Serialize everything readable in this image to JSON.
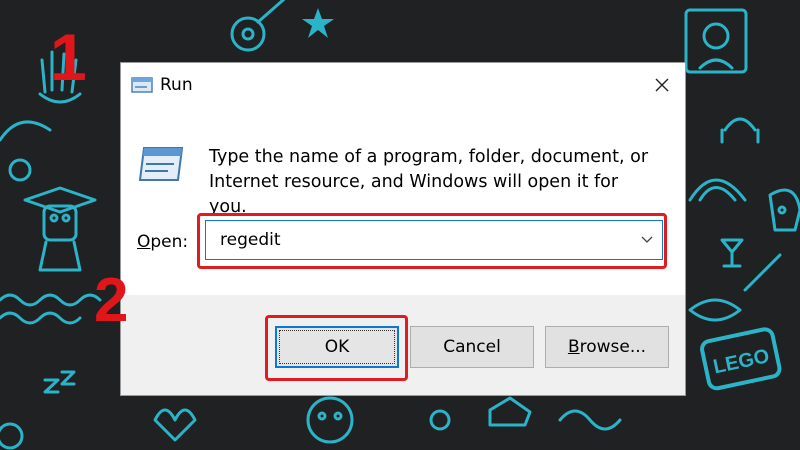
{
  "dialog": {
    "title": "Run",
    "description_line1": "Type the name of a program, folder, document, or",
    "description_line2": "Internet resource, and Windows will open it for you.",
    "open_label_mnemonic": "O",
    "open_label_rest": "pen:",
    "open_value": "regedit",
    "buttons": {
      "ok": "OK",
      "cancel": "Cancel",
      "browse_mnemonic": "B",
      "browse_rest": "rowse..."
    }
  },
  "annotations": {
    "step1": "1",
    "step2": "2"
  },
  "background": {
    "logo_text": "LEGO"
  },
  "colors": {
    "highlight": "#e01b22",
    "focus_blue": "#0a78d7",
    "doodle": "#2bb3c8",
    "background": "#1f2123"
  }
}
